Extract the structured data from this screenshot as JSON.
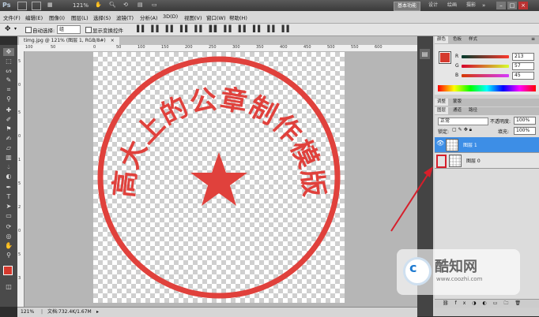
{
  "app": {
    "logo": "Ps",
    "zoom": "121%"
  },
  "workspaces": {
    "essentials": "基本功能",
    "design": "设计",
    "painting": "绘画",
    "photography": "摄影"
  },
  "window_controls": {
    "minimize": "–",
    "restore": "□",
    "close": "×"
  },
  "menu": [
    "文件(F)",
    "编辑(E)",
    "图像(I)",
    "图层(L)",
    "选择(S)",
    "滤镜(T)",
    "分析(A)",
    "3D(D)",
    "视图(V)",
    "窗口(W)",
    "帮助(H)"
  ],
  "options": {
    "auto_select_label": "自动选择:",
    "auto_select_value": "组",
    "show_transform_label": "显示变换控件"
  },
  "document": {
    "tab_label": "timg.jpg @ 121% (图层 1, RGB/8#)",
    "tab_close": "×"
  },
  "ruler": {
    "h_ticks": [
      "100",
      "50",
      "0",
      "50",
      "100",
      "150",
      "200",
      "250",
      "300",
      "350",
      "400",
      "450",
      "500",
      "550",
      "600"
    ],
    "v_ticks": [
      "5",
      "0",
      "5",
      "0",
      "1",
      "5",
      "2",
      "0",
      "5",
      "3"
    ]
  },
  "seal": {
    "text": "高大上的公章制作模版",
    "color": "#e0413c"
  },
  "status": {
    "zoom": "121%",
    "doc_info": "文档:732.4K/1.67M"
  },
  "color_panel": {
    "tabs": [
      "颜色",
      "色板",
      "样式"
    ],
    "r_label": "R",
    "g_label": "G",
    "b_label": "B",
    "r_value": "213",
    "g_value": "57",
    "b_value": "45",
    "fg_color": "#d5392d"
  },
  "adjust_tabs": [
    "调整",
    "蒙版"
  ],
  "layers_panel": {
    "tabs": [
      "图层",
      "通道",
      "路径"
    ],
    "blend_mode": "正常",
    "opacity_label": "不透明度:",
    "opacity_value": "100%",
    "lock_label": "锁定:",
    "fill_label": "填充:",
    "fill_value": "100%",
    "layers": [
      {
        "name": "图层 1",
        "selected": true,
        "visible": true
      },
      {
        "name": "图层 0",
        "selected": false,
        "visible": false
      }
    ]
  },
  "watermark": {
    "name": "酷知网",
    "url": "www.coozhi.com"
  },
  "annotation_color": "#d61f2b"
}
